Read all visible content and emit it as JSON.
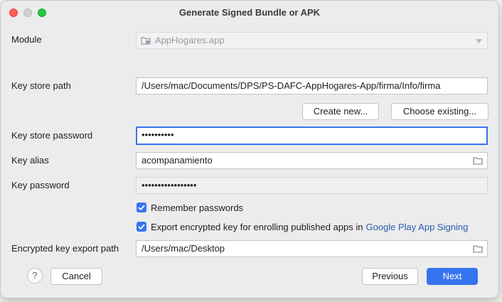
{
  "window": {
    "title": "Generate Signed Bundle or APK"
  },
  "module": {
    "label": "Module",
    "value": "AppHogares.app"
  },
  "keystore": {
    "path_label": "Key store path",
    "path_value": "/Users/mac/Documents/DPS/PS-DAFC-AppHogares-App/firma/Info/firma",
    "create_new_label": "Create new...",
    "choose_existing_label": "Choose existing...",
    "password_label": "Key store password",
    "password_value": "••••••••••",
    "alias_label": "Key alias",
    "alias_value": "acompanamiento",
    "key_password_label": "Key password",
    "key_password_value": "•••••••••••••••••"
  },
  "options": {
    "remember_label": "Remember passwords",
    "remember_checked": true,
    "export_label": "Export encrypted key for enrolling published apps in",
    "export_link": "Google Play App Signing",
    "export_checked": true
  },
  "export_path": {
    "label": "Encrypted key export path",
    "value": "/Users/mac/Desktop"
  },
  "footer": {
    "help_label": "?",
    "cancel_label": "Cancel",
    "previous_label": "Previous",
    "next_label": "Next"
  },
  "colors": {
    "accent": "#3574f0",
    "link": "#2a5db0"
  }
}
